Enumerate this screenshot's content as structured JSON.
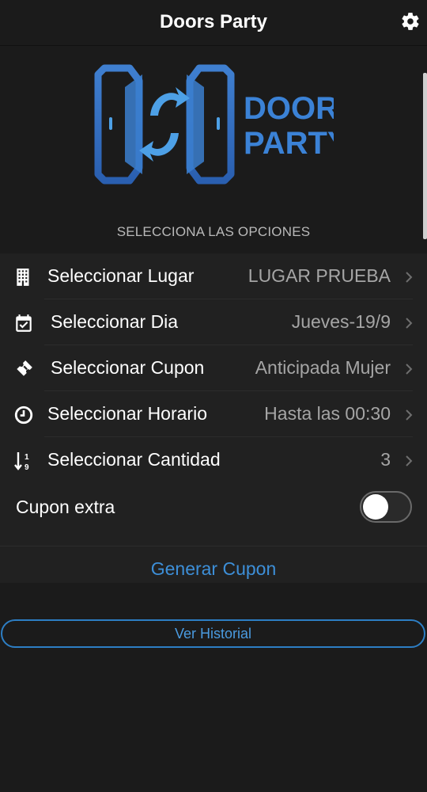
{
  "header": {
    "title": "Doors Party",
    "settings_icon": "gear-icon"
  },
  "logo": {
    "line1": "DOORS",
    "line2": "PARTY"
  },
  "section": {
    "title": "SELECCIONA LAS OPCIONES"
  },
  "options": [
    {
      "icon": "building-icon",
      "label": "Seleccionar Lugar",
      "value": "LUGAR PRUEBA"
    },
    {
      "icon": "calendar-check-icon",
      "label": "Seleccionar Dia",
      "value": "Jueves-19/9"
    },
    {
      "icon": "ticket-icon",
      "label": "Seleccionar Cupon",
      "value": "Anticipada Mujer"
    },
    {
      "icon": "clock-icon",
      "label": "Seleccionar Horario",
      "value": "Hasta las 00:30"
    },
    {
      "icon": "sort-numeric-icon",
      "label": "Seleccionar Cantidad",
      "value": "3"
    }
  ],
  "extra": {
    "label": "Cupon extra",
    "enabled": false
  },
  "actions": {
    "generate": "Generar Cupon",
    "history": "Ver Historial"
  },
  "colors": {
    "background": "#1b1b1b",
    "card": "#212121",
    "accent": "#3d8fd8",
    "muted_text": "#a5a5a5"
  }
}
